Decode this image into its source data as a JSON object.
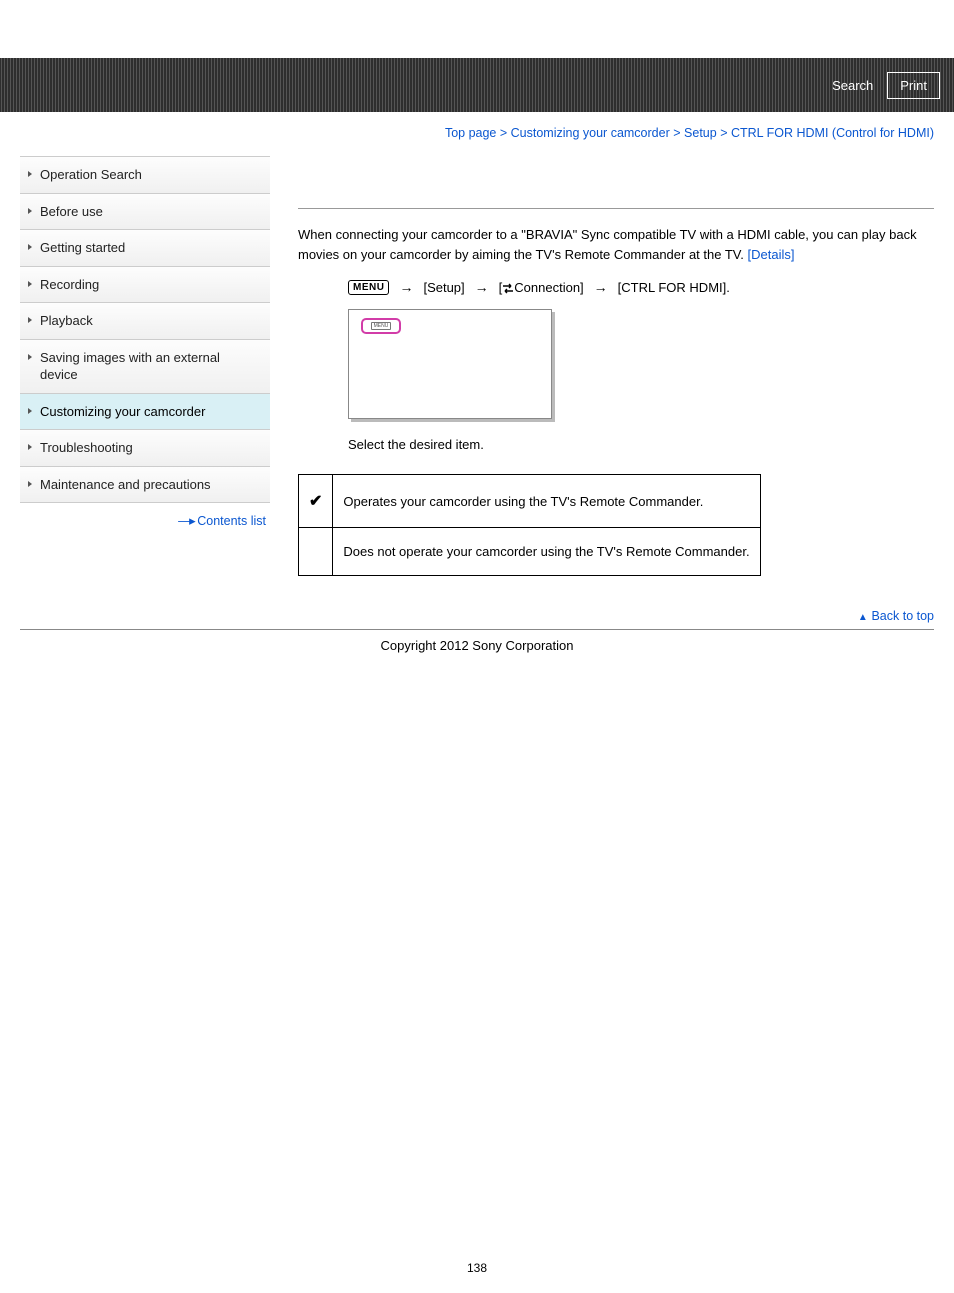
{
  "header": {
    "search_label": "Search",
    "print_label": "Print"
  },
  "breadcrumb": {
    "items": [
      "Top page",
      "Customizing your camcorder",
      "Setup",
      "CTRL FOR HDMI (Control for HDMI)"
    ],
    "sep": ">"
  },
  "sidebar": {
    "items": [
      {
        "label": "Operation Search",
        "active": false
      },
      {
        "label": "Before use",
        "active": false
      },
      {
        "label": "Getting started",
        "active": false
      },
      {
        "label": "Recording",
        "active": false
      },
      {
        "label": "Playback",
        "active": false
      },
      {
        "label": "Saving images with an external device",
        "active": false
      },
      {
        "label": "Customizing your camcorder",
        "active": true
      },
      {
        "label": "Troubleshooting",
        "active": false
      },
      {
        "label": "Maintenance and precautions",
        "active": false
      }
    ],
    "contents_list_label": "Contents list"
  },
  "main": {
    "intro_text": "When connecting your camcorder to a \"BRAVIA\" Sync compatible TV with a HDMI cable, you can play back movies on your camcorder by aiming the TV's Remote Commander at the TV. ",
    "details_label": "[Details]",
    "menu_icon_text": "MENU",
    "path_setup": "[Setup]",
    "path_connection": "Connection]",
    "path_ctrl": "[CTRL FOR HDMI].",
    "screen_tiny_text": "MENU",
    "select_text": "Select the desired item.",
    "options": [
      {
        "checked": true,
        "desc": "Operates your camcorder using the TV's Remote Commander."
      },
      {
        "checked": false,
        "desc": "Does not operate your camcorder using the TV's Remote Commander."
      }
    ]
  },
  "footer": {
    "back_to_top": "Back to top",
    "copyright": "Copyright 2012 Sony Corporation",
    "page_number": "138"
  }
}
